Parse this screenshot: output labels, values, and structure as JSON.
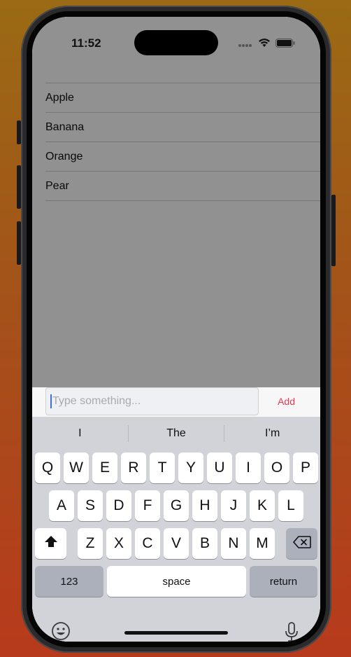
{
  "status_bar": {
    "time": "11:52"
  },
  "list": {
    "items": [
      "Apple",
      "Banana",
      "Orange",
      "Pear"
    ]
  },
  "input": {
    "placeholder": "Type something...",
    "add_label": "Add"
  },
  "keyboard": {
    "suggestions": [
      "I",
      "The",
      "I’m"
    ],
    "row1": [
      "Q",
      "W",
      "E",
      "R",
      "T",
      "Y",
      "U",
      "I",
      "O",
      "P"
    ],
    "row2": [
      "A",
      "S",
      "D",
      "F",
      "G",
      "H",
      "J",
      "K",
      "L"
    ],
    "row3": [
      "Z",
      "X",
      "C",
      "V",
      "B",
      "N",
      "M"
    ],
    "numbers_label": "123",
    "space_label": "space",
    "return_label": "return"
  },
  "colors": {
    "accent": "#e53950",
    "caret": "#3b6fe6"
  },
  "icons": [
    "wifi-icon",
    "battery-icon",
    "shift-icon",
    "backspace-icon",
    "emoji-icon",
    "microphone-icon"
  ]
}
